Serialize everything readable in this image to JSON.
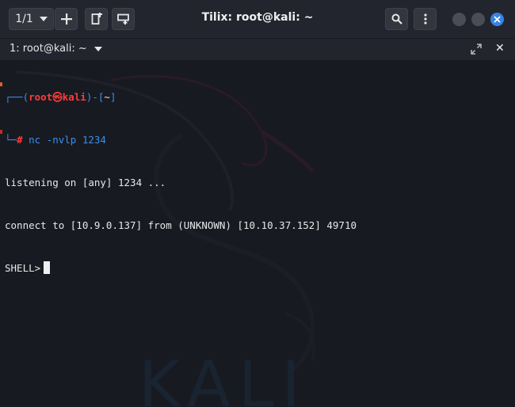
{
  "header": {
    "session_label": "1/1",
    "title": "Tilix: root@kali: ~"
  },
  "tab": {
    "title": "1: root@kali: ~",
    "close_glyph": "✕"
  },
  "terminal": {
    "prompt_open": "┌──(",
    "prompt_user": "root㉿kali",
    "prompt_mid": ")-[",
    "prompt_path": "~",
    "prompt_close": "]",
    "prompt_line2": "└─",
    "prompt_hash": "#",
    "command": " nc -nvlp 1234",
    "output_1": "listening on [any] 1234 ...",
    "output_2": "connect to [10.9.0.137] from (UNKNOWN) [10.10.37.152] 49710",
    "shell_prompt": "SHELL>"
  },
  "watermark": {
    "text": "KALI"
  },
  "colors": {
    "accent_blue": "#3584e4",
    "prompt_blue": "#3b8eea",
    "prompt_red": "#ff3b3b",
    "terminal_bg": "#171a21",
    "titlebar_bg": "#23252e"
  },
  "icons": [
    "caret-down-icon",
    "plus-icon",
    "add-right-icon",
    "add-down-icon",
    "search-icon",
    "kebab-menu-icon",
    "close-icon",
    "maximize-icon",
    "kali-dragon-icon"
  ]
}
